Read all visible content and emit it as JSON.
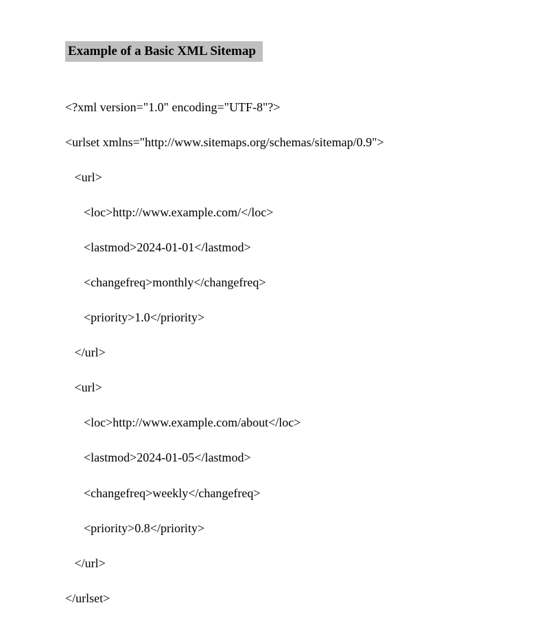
{
  "heading": "Example of a Basic XML Sitemap",
  "code": {
    "l1": "<?xml version=\"1.0\" encoding=\"UTF-8\"?>",
    "l2": "<urlset xmlns=\"http://www.sitemaps.org/schemas/sitemap/0.9\">",
    "l3": "   <url>",
    "l4": "      <loc>http://www.example.com/</loc>",
    "l5": "      <lastmod>2024-01-01</lastmod>",
    "l6": "      <changefreq>monthly</changefreq>",
    "l7": "      <priority>1.0</priority>",
    "l8": "   </url>",
    "l9": "   <url>",
    "l10": "      <loc>http://www.example.com/about</loc>",
    "l11": "      <lastmod>2024-01-05</lastmod>",
    "l12": "      <changefreq>weekly</changefreq>",
    "l13": "      <priority>0.8</priority>",
    "l14": "   </url>",
    "l15": "</urlset>"
  }
}
